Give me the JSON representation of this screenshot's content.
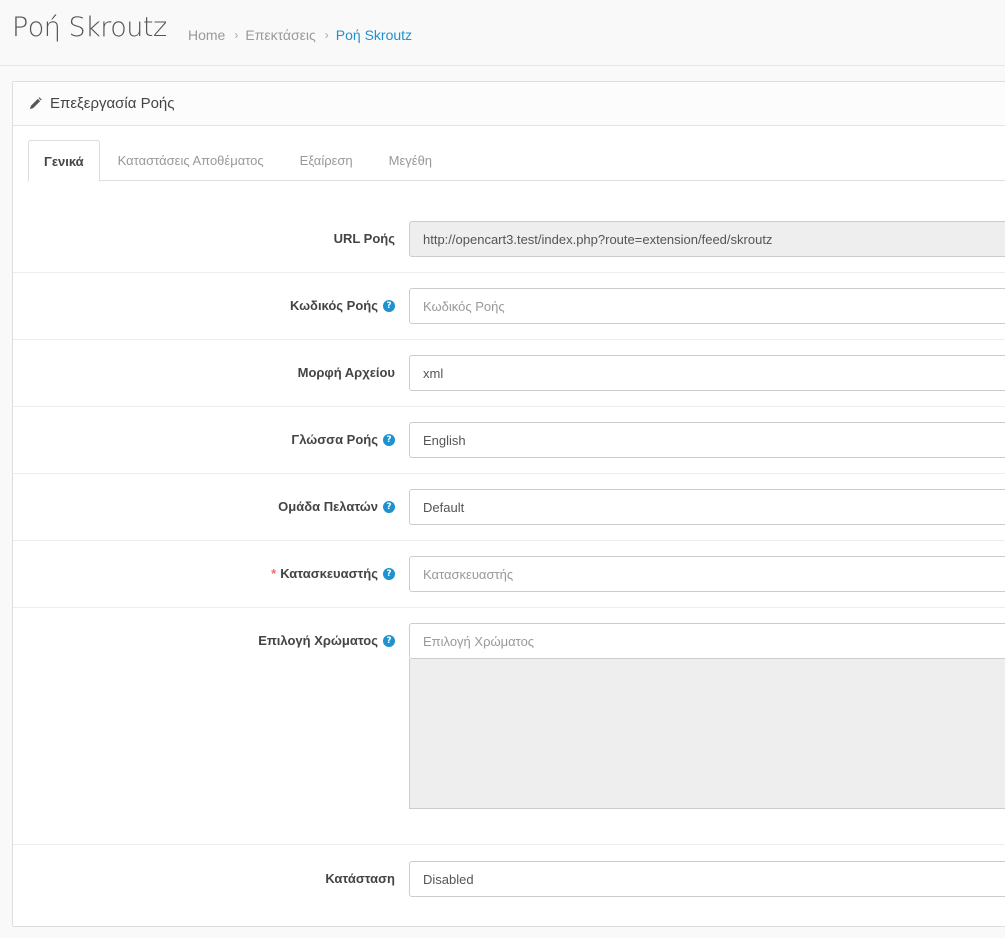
{
  "header": {
    "title": "Ροή Skroutz",
    "breadcrumb": [
      "Home",
      "Επεκτάσεις",
      "Ροή Skroutz"
    ],
    "separator": "›"
  },
  "panel": {
    "heading": "Επεξεργασία Ροής",
    "heading_icon": "pencil-icon"
  },
  "tabs": [
    "Γενικά",
    "Καταστάσεις Αποθέματος",
    "Εξαίρεση",
    "Μεγέθη"
  ],
  "active_tab": "Γενικά",
  "form": {
    "feed_url": {
      "label": "URL Ροής",
      "value": "http://opencart3.test/index.php?route=extension/feed/skroutz"
    },
    "feed_code": {
      "label": "Κωδικός Ροής",
      "placeholder": "Κωδικός Ροής"
    },
    "file_format": {
      "label": "Μορφή Αρχείου",
      "value": "xml"
    },
    "feed_language": {
      "label": "Γλώσσα Ροής",
      "value": "English"
    },
    "customer_group": {
      "label": "Ομάδα Πελατών",
      "value": "Default"
    },
    "manufacturer": {
      "label": "Κατασκευαστής",
      "required_mark": "*",
      "placeholder": "Κατασκευαστής"
    },
    "color_select": {
      "label": "Επιλογή Χρώματος",
      "placeholder": "Επιλογή Χρώματος"
    },
    "status": {
      "label": "Κατάσταση",
      "value": "Disabled"
    }
  },
  "help_glyph": "?",
  "colors": {
    "accent": "#1e91cf",
    "required": "#f56b6b"
  }
}
